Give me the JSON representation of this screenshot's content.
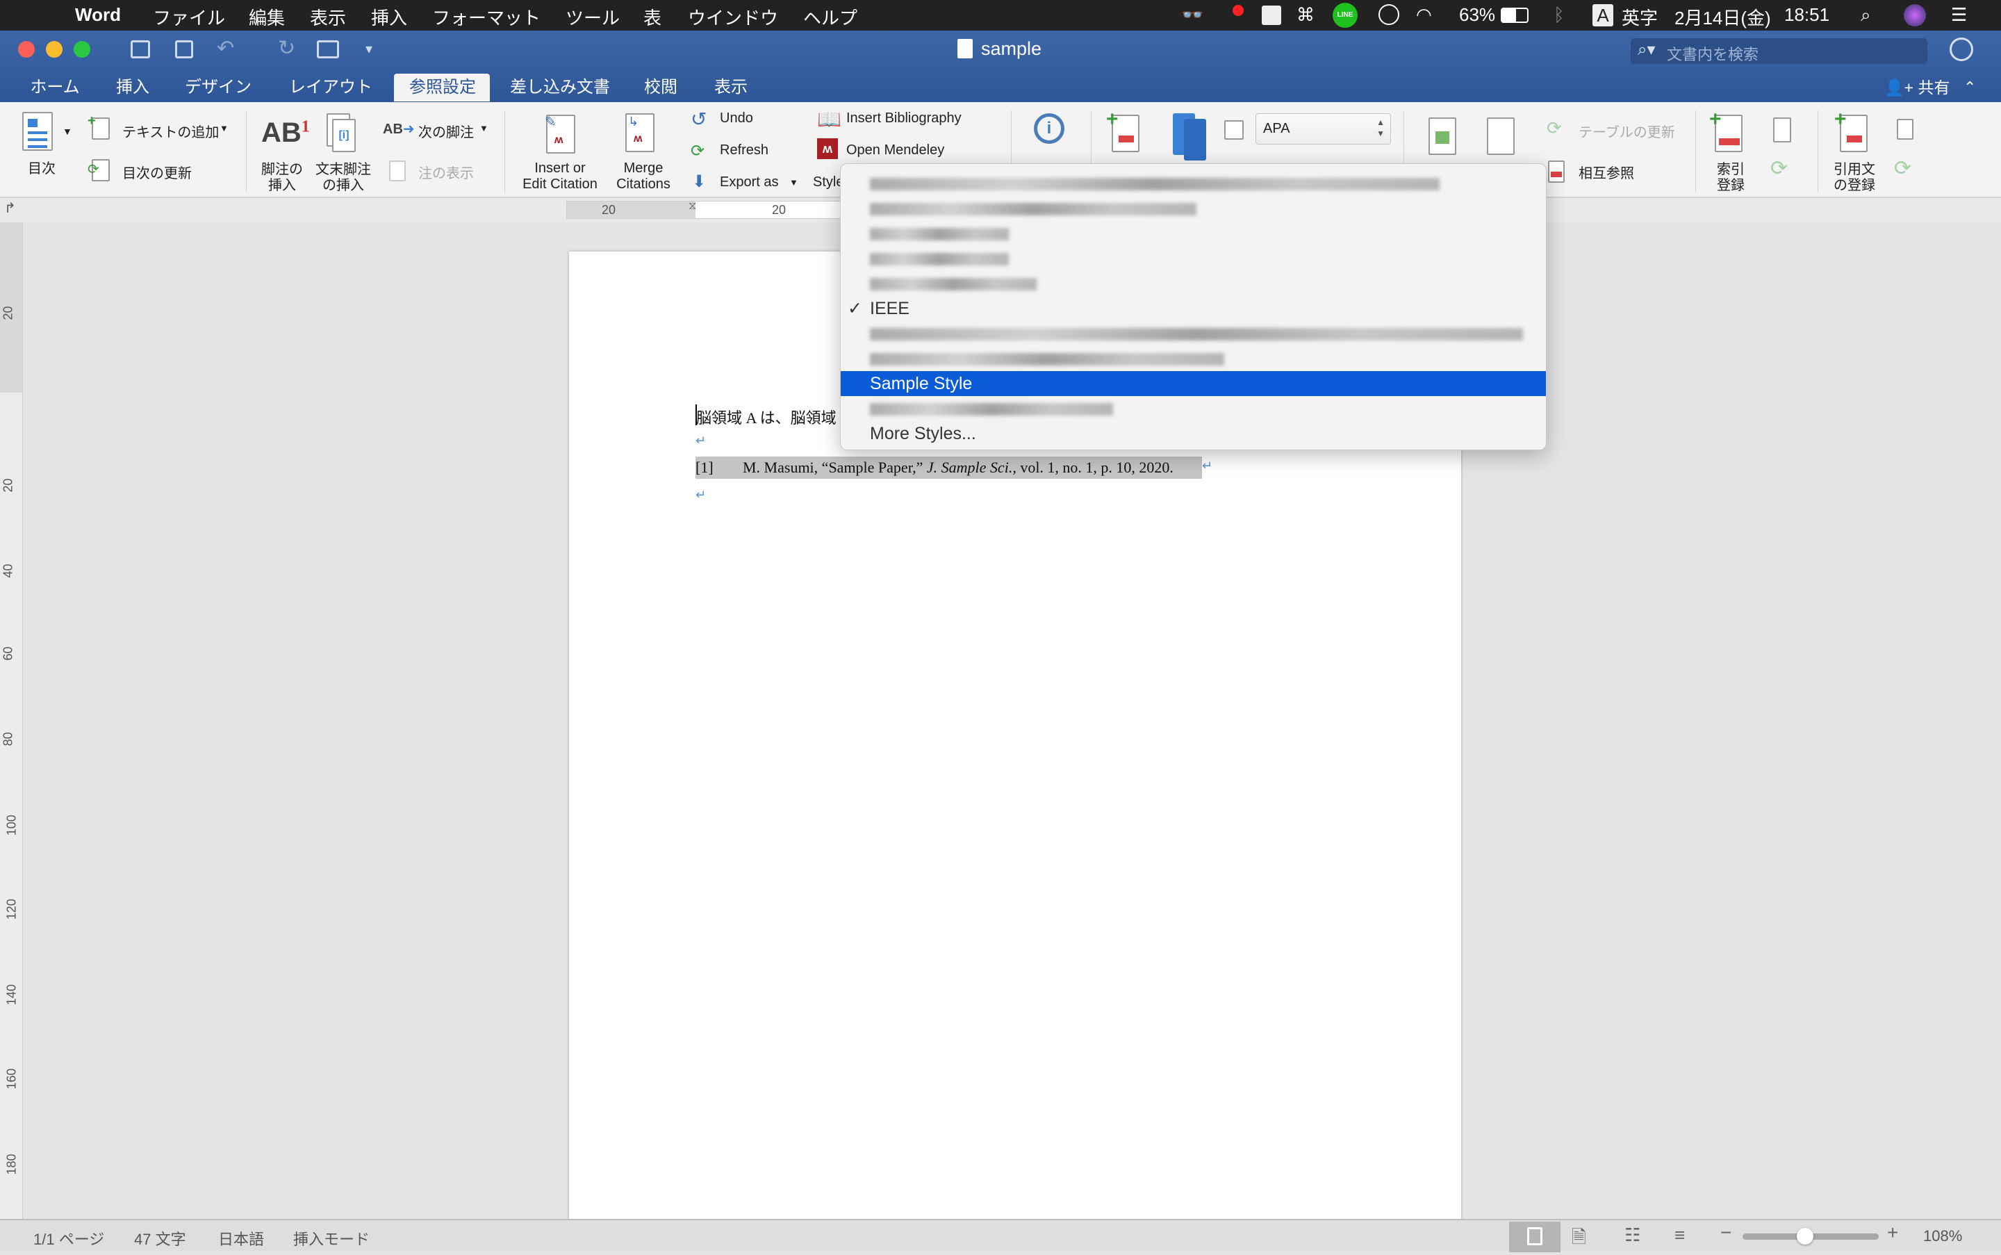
{
  "menubar": {
    "app": "Word",
    "items": [
      "ファイル",
      "編集",
      "表示",
      "挿入",
      "フォーマット",
      "ツール",
      "表",
      "ウインドウ",
      "ヘルプ"
    ],
    "battery": "63%",
    "input_mode": "英字",
    "input_badge": "A",
    "date": "2月14日(金)",
    "time": "18:51",
    "line_label": "LINE"
  },
  "window": {
    "title": "sample",
    "search_placeholder": "文書内を検索",
    "share": "共有"
  },
  "tabs": [
    {
      "label": "ホーム"
    },
    {
      "label": "挿入"
    },
    {
      "label": "デザイン"
    },
    {
      "label": "レイアウト"
    },
    {
      "label": "参照設定",
      "active": true
    },
    {
      "label": "差し込み文書"
    },
    {
      "label": "校閲"
    },
    {
      "label": "表示"
    }
  ],
  "ribbon": {
    "toc": "目次",
    "add_text": "テキストの追加",
    "update_toc": "目次の更新",
    "insert_footnote": [
      "脚注の",
      "挿入"
    ],
    "insert_endnote": [
      "文末脚注",
      "の挿入"
    ],
    "next_footnote": "次の脚注",
    "show_notes": "注の表示",
    "insert_citation": [
      "Insert or",
      "Edit Citation"
    ],
    "merge_citations": [
      "Merge",
      "Citations"
    ],
    "undo": "Undo",
    "refresh": "Refresh",
    "export_as": "Export as",
    "style": "Style",
    "insert_bibliography": "Insert Bibliography",
    "open_mendeley": "Open Mendeley",
    "citation_style": "APA",
    "update_table": "テーブルの更新",
    "cross_reference": "相互参照",
    "mark_entry": [
      "索引",
      "登録"
    ],
    "mark_citation": [
      "引用文",
      "の登録"
    ]
  },
  "ruler": {
    "h_labels": [
      "20",
      "20"
    ],
    "v_labels": [
      "20",
      "20",
      "40",
      "60",
      "80",
      "100",
      "120",
      "140",
      "160",
      "180"
    ]
  },
  "document": {
    "line1": "脳領域 A は、脳領域",
    "ref_number": "[1]",
    "ref_text_before": "M. Masumi, “Sample Paper,” ",
    "ref_journal": "J. Sample Sci.",
    "ref_text_after": ", vol. 1, no. 1, p. 10, 2020."
  },
  "style_dropdown": {
    "items": [
      {
        "label": "",
        "blurred": true
      },
      {
        "label": "",
        "blurred": true
      },
      {
        "label": "",
        "blurred": true
      },
      {
        "label": "",
        "blurred": true
      },
      {
        "label": "",
        "blurred": true
      },
      {
        "label": "IEEE",
        "checked": true
      },
      {
        "label": "",
        "blurred": true
      },
      {
        "label": "",
        "blurred": true
      },
      {
        "label": "Sample Style",
        "selected": true
      },
      {
        "label": "",
        "blurred": true
      },
      {
        "label": "More Styles..."
      }
    ],
    "check_mark": "✓"
  },
  "statusbar": {
    "page": "1/1 ページ",
    "words": "47 文字",
    "language": "日本語",
    "mode": "挿入モード",
    "zoom": "108%",
    "zoom_level_fraction": 0.46
  },
  "colors": {
    "ribbon_blue": "#2d5597",
    "selection": "#0a5bd6",
    "mendeley_red": "#a81e22"
  }
}
